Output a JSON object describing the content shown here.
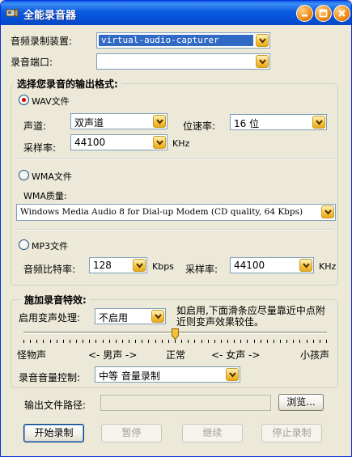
{
  "window": {
    "title": "全能录音器"
  },
  "device": {
    "label": "音频录制装置:",
    "value": "virtual-audio-capturer"
  },
  "port": {
    "label": "录音端口:",
    "value": ""
  },
  "format_group": {
    "title": "选择您录音的输出格式:",
    "wav": {
      "label": "WAV文件",
      "channel_label": "声道:",
      "channel_value": "双声道",
      "bitrate_label": "位速率:",
      "bitrate_value": "16 位",
      "samplerate_label": "采样率:",
      "samplerate_value": "44100",
      "samplerate_unit": "KHz"
    },
    "wma": {
      "label": "WMA文件",
      "quality_label": "WMA质量:",
      "quality_value": "Windows Media Audio 8 for Dial-up Modem (CD quality, 64 Kbps)"
    },
    "mp3": {
      "label": "MP3文件",
      "bitrate_label": "音频比特率:",
      "bitrate_value": "128",
      "bitrate_unit": "Kbps",
      "samplerate_label": "采样率:",
      "samplerate_value": "44100",
      "samplerate_unit": "KHz"
    }
  },
  "effects_group": {
    "title": "施加录音特效:",
    "voice_label": "启用变声处理:",
    "voice_value": "不启用",
    "note": "如启用,下面滑条应尽量靠近中点附近则变声效果较佳。",
    "slider_labels": [
      "怪物声",
      "<- 男声 ->",
      "正常",
      "<- 女声 ->",
      "小孩声"
    ],
    "slider_value": 0.5,
    "volume_label": "录音音量控制:",
    "volume_value": "中等 音量录制"
  },
  "output": {
    "label": "输出文件路径:",
    "value": "",
    "browse_label": "浏览..."
  },
  "buttons": {
    "start": "开始录制",
    "pause": "暂停",
    "resume": "继续",
    "stop": "停止录制"
  }
}
